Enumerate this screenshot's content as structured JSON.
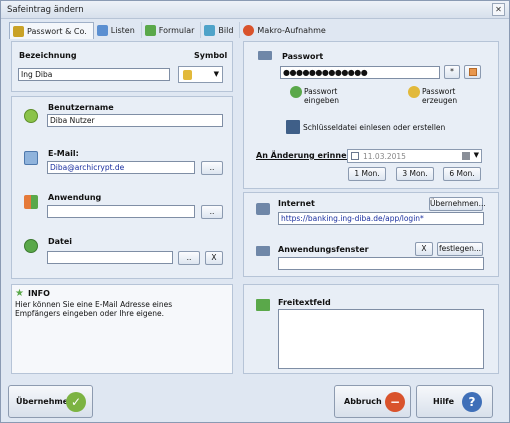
{
  "window": {
    "title": "Safeintrag ändern"
  },
  "tabs": [
    {
      "label": "Passwort & Co."
    },
    {
      "label": "Listen"
    },
    {
      "label": "Formular"
    },
    {
      "label": "Bild"
    },
    {
      "label": "Makro-Aufnahme"
    }
  ],
  "left": {
    "bezeichnung_label": "Bezeichnung",
    "bezeichnung_value": "Ing Diba",
    "symbol_label": "Symbol",
    "benutzername_label": "Benutzername",
    "benutzername_value": "Diba Nutzer",
    "email_label": "E-Mail:",
    "email_value": "Diba@archicrypt.de",
    "anwendung_label": "Anwendung",
    "anwendung_value": "",
    "datei_label": "Datei",
    "datei_value": "",
    "browse_label": "..",
    "clear_label": "X",
    "info_title": "INFO",
    "info_text": "Hier können Sie eine E-Mail Adresse eines Empfängers eingeben oder Ihre eigene."
  },
  "right": {
    "passwort_label": "Passwort",
    "passwort_value": "●●●●●●●●●●●●●",
    "star_label": "*",
    "passwort_eingeben": [
      "Passwort",
      "eingeben"
    ],
    "passwort_erzeugen": [
      "Passwort",
      "erzeugen"
    ],
    "schluessel_label": "Schlüsseldatei einlesen oder erstellen",
    "erinnern_label": "An Änderung erinnern",
    "date_value": "11.03.2015",
    "period_buttons": [
      "1 Mon.",
      "3 Mon.",
      "6 Mon."
    ],
    "internet_label": "Internet",
    "uebernehmen_small": "Übernehmen...",
    "internet_value": "https://banking.ing-diba.de/app/login*",
    "anwendungsfenster_label": "Anwendungsfenster",
    "festlegen_label": "festlegen...",
    "anwendungsfenster_value": "",
    "freitext_label": "Freitextfeld",
    "freitext_value": ""
  },
  "footer": {
    "uebernehmen": "Übernehmen",
    "abbruch": "Abbruch",
    "hilfe": "Hilfe"
  },
  "colors": {
    "accent": "#2d5fa8",
    "ok_green": "#7cb342",
    "cancel_red": "#d9532c",
    "help_blue": "#3f6fb8"
  }
}
